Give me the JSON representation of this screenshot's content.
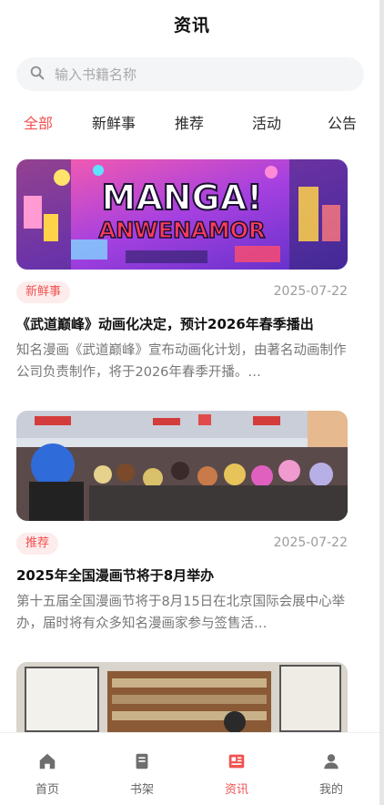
{
  "header": {
    "title": "资讯"
  },
  "search": {
    "placeholder": "输入书籍名称"
  },
  "colors": {
    "accent": "#f25151",
    "tag_bg": "#fdecec",
    "muted": "#9b9b9b"
  },
  "tabs": [
    {
      "label": "全部",
      "active": true
    },
    {
      "label": "新鲜事",
      "active": false
    },
    {
      "label": "推荐",
      "active": false
    },
    {
      "label": "活动",
      "active": false
    },
    {
      "label": "公告",
      "active": false
    }
  ],
  "articles": [
    {
      "image_text_line1": "MANGA!",
      "image_text_line2": "ANWENAMOR",
      "tag": "新鲜事",
      "date": "2025-07-22",
      "title": "《武道巅峰》动画化决定，预计2026年春季播出",
      "summary": "知名漫画《武道巅峰》宣布动画化计划，由著名动画制作公司负责制作，将于2026年春季开播。…"
    },
    {
      "tag": "推荐",
      "date": "2025-07-22",
      "title": "2025年全国漫画节将于8月举办",
      "summary": "第十五届全国漫画节将于8月15日在北京国际会展中心举办，届时将有众多知名漫画家参与签售活…"
    },
    {}
  ],
  "tabbar": [
    {
      "label": "首页",
      "icon": "home-icon",
      "active": false
    },
    {
      "label": "书架",
      "icon": "bookshelf-icon",
      "active": false
    },
    {
      "label": "资讯",
      "icon": "news-icon",
      "active": true
    },
    {
      "label": "我的",
      "icon": "profile-icon",
      "active": false
    }
  ]
}
